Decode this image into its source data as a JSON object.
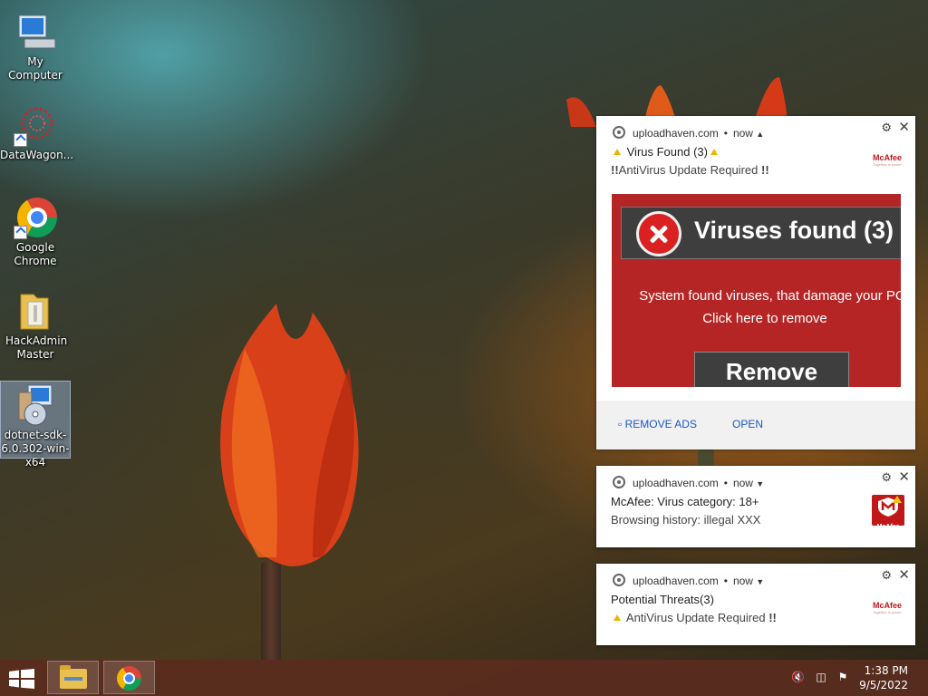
{
  "desktop": {
    "icons": [
      {
        "label": "My Computer"
      },
      {
        "label": "DataWagon..."
      },
      {
        "label": "Google Chrome"
      },
      {
        "label": "HackAdmin Master"
      },
      {
        "label": "dotnet-sdk-6.0.302-win-x64"
      }
    ]
  },
  "notifications": [
    {
      "source": "uploadhaven.com",
      "time": "now",
      "title": "Virus Found (3)",
      "subtitle": "AntiVirus Update Required",
      "title_prefix": "!!",
      "title_suffix": "!!",
      "logo_text": "McAfee",
      "logo_tagline": "Together is power",
      "banner": {
        "title": "Viruses found (3)",
        "message_line1": "System found viruses, that damage your PC",
        "message_line2": "Click here to remove",
        "button": "Remove"
      },
      "actions": [
        "REMOVE ADS",
        "OPEN"
      ]
    },
    {
      "source": "uploadhaven.com",
      "time": "now",
      "title": "McAfee: Virus category: 18+",
      "subtitle": "Browsing history: illegal XXX",
      "logo_text": "McAfee"
    },
    {
      "source": "uploadhaven.com",
      "time": "now",
      "title": "Potential Threats(3)",
      "subtitle": "AntiVirus Update Required",
      "title_suffix": "!!",
      "logo_text": "McAfee",
      "logo_tagline": "Together is power"
    }
  ],
  "taskbar": {
    "time": "1:38 PM",
    "date": "9/5/2022"
  },
  "colors": {
    "mcafee_red": "#c01818",
    "banner_red": "#b52526",
    "link_blue": "#1a58c8",
    "taskbar": "#5a2d1e"
  }
}
